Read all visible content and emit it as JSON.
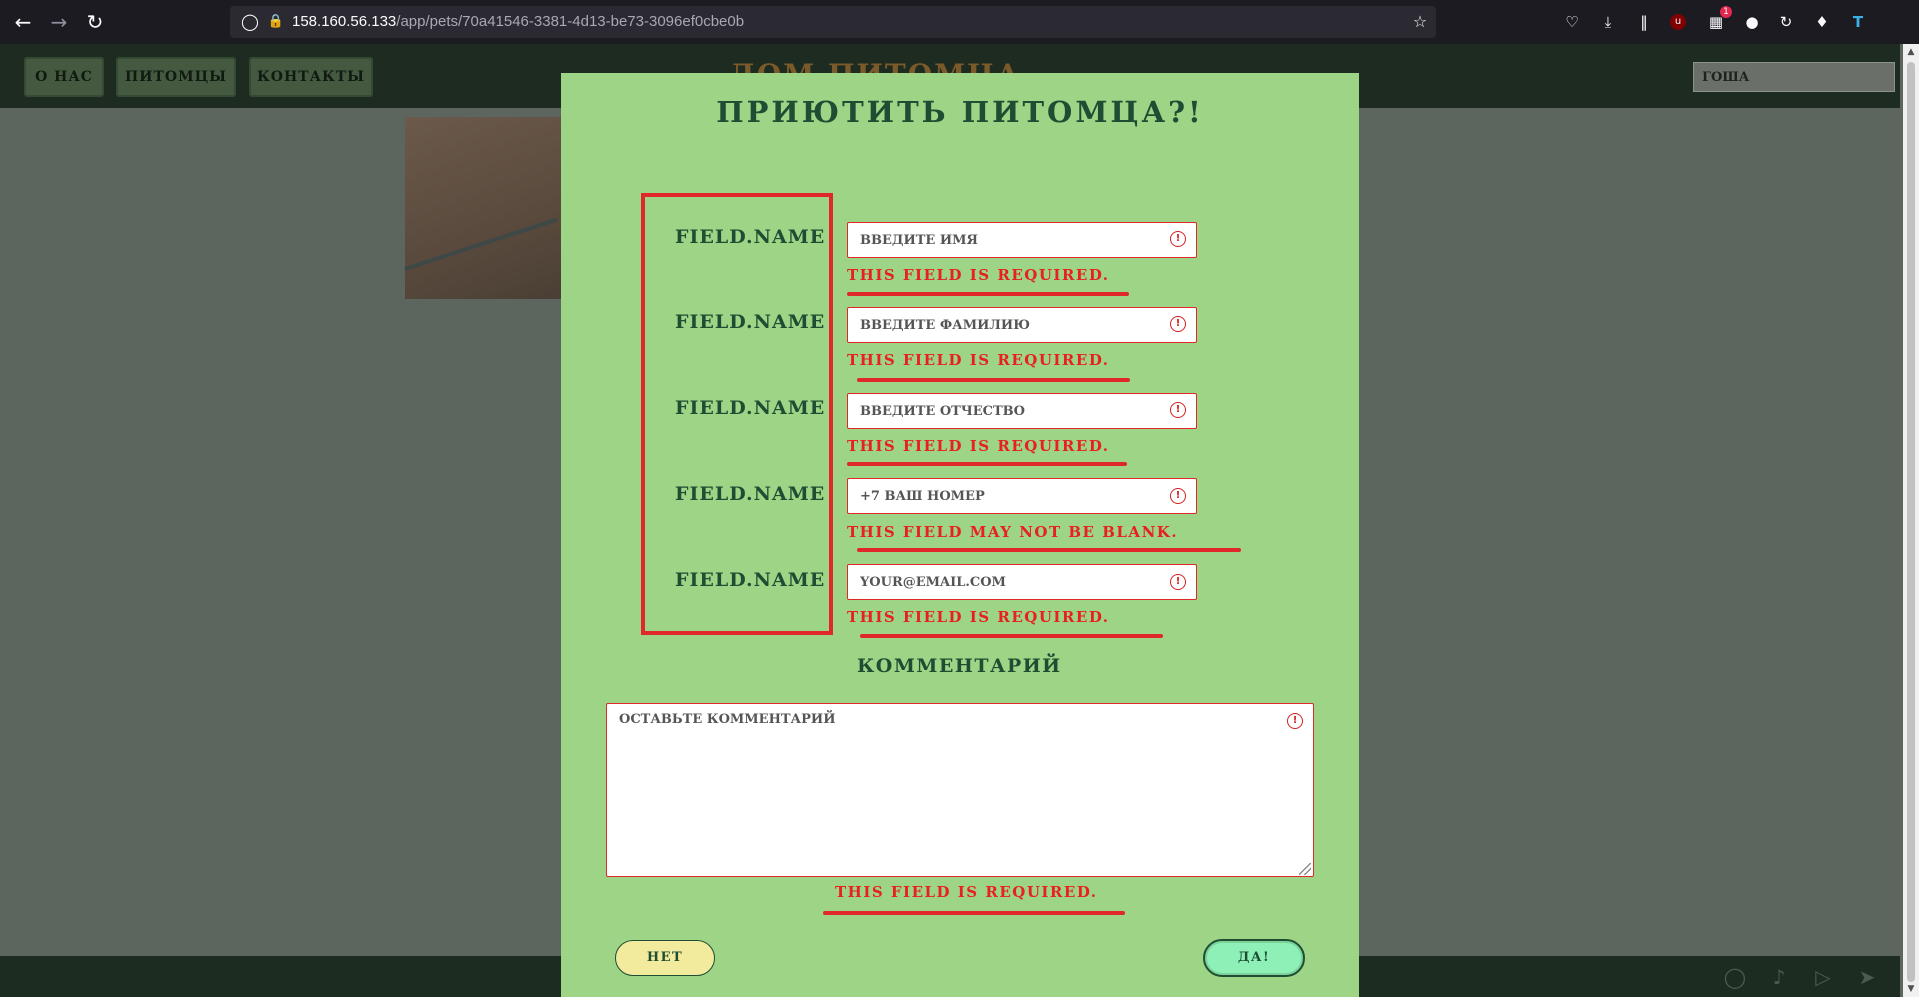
{
  "browser": {
    "url_host": "158.160.56.133",
    "url_path": "/app/pets/70a41546-3381-4d13-be73-3096ef0cbe0b",
    "notification_badge": "1",
    "icons": [
      "back-icon",
      "forward-icon",
      "reload-icon",
      "shield-icon",
      "lock-icon",
      "star-icon",
      "pocket-icon",
      "download-icon",
      "library-icon",
      "ublock-icon",
      "extension-badge-icon",
      "globe-icon",
      "sync-icon",
      "extensions-icon",
      "translate-icon"
    ]
  },
  "site": {
    "nav": [
      "О НАС",
      "ПИТОМЦЫ",
      "КОНТАКТЫ"
    ],
    "logo": "ДОМ ПИТОМЦА",
    "user": "ГОША",
    "footer_icons": [
      "instagram-icon",
      "tiktok-icon",
      "youtube-icon",
      "telegram-icon"
    ]
  },
  "modal": {
    "title": "ПРИЮТИТЬ ПИТОМЦА?!",
    "fields": [
      {
        "label": "FIELD.NAME",
        "placeholder": "ВВЕДИТЕ ИМЯ",
        "error": "THIS FIELD IS REQUIRED."
      },
      {
        "label": "FIELD.NAME",
        "placeholder": "ВВЕДИТЕ ФАМИЛИЮ",
        "error": "THIS FIELD IS REQUIRED."
      },
      {
        "label": "FIELD.NAME",
        "placeholder": "ВВЕДИТЕ ОТЧЕСТВО",
        "error": "THIS FIELD IS REQUIRED."
      },
      {
        "label": "FIELD.NAME",
        "placeholder": "+7 ВАШ НОМЕР",
        "error": "THIS FIELD MAY NOT BE BLANK."
      },
      {
        "label": "FIELD.NAME",
        "placeholder": "YOUR@EMAIL.COM",
        "error": "THIS FIELD IS REQUIRED."
      }
    ],
    "comment_heading": "КОММЕНТАРИЙ",
    "comment_placeholder": "ОСТАВЬТЕ КОММЕНТАРИЙ",
    "comment_error": "THIS FIELD IS REQUIRED.",
    "no_label": "НЕТ",
    "yes_label": "ДА!",
    "colors": {
      "modal_bg": "#9ed485",
      "heading": "#1e4d33",
      "error": "#e82020",
      "no_button": "#f2eb9d",
      "yes_button": "#8ef0b6"
    }
  }
}
